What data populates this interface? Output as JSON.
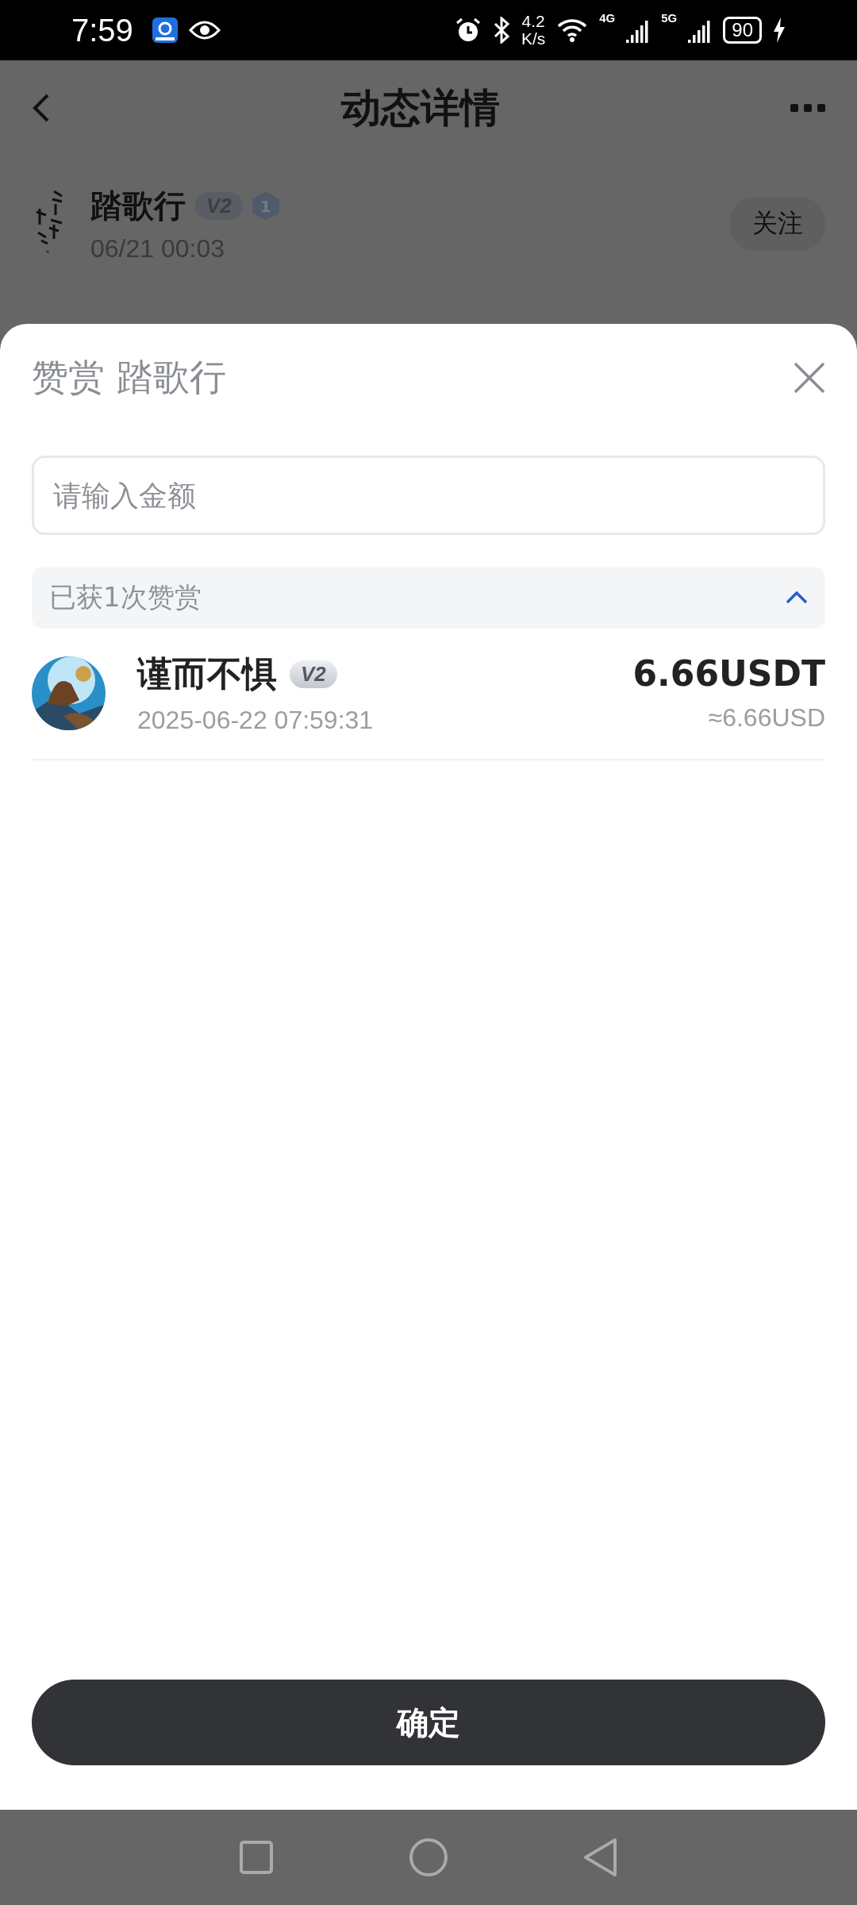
{
  "status_bar": {
    "time": "7:59",
    "speed_value": "4.2",
    "speed_unit": "K/s",
    "signals": [
      {
        "label": "4G"
      },
      {
        "label": "5G"
      }
    ],
    "battery": "90"
  },
  "page": {
    "title": "动态详情",
    "author": {
      "name": "踏歌行",
      "level_badge": "V2",
      "rank_badge": "1",
      "date": "06/21 00:03"
    },
    "follow": "关注"
  },
  "sheet": {
    "title": "赞赏 踏歌行",
    "amount_field": {
      "placeholder": "请输入金额"
    },
    "rewards": {
      "summary": "已获1次赞赏",
      "expanded": true,
      "items": [
        {
          "name": "谨而不惧",
          "badge": "V2",
          "time": "2025-06-22 07:59:31",
          "amount": "6.66USDT",
          "approx": "≈6.66USD"
        }
      ]
    },
    "confirm": "确定"
  }
}
